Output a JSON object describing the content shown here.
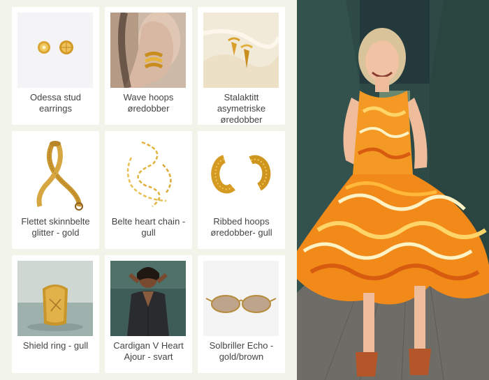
{
  "products": [
    {
      "name": "Odessa stud earrings",
      "thumb_icon": "stud-earrings-icon"
    },
    {
      "name": "Wave hoops øredobber",
      "thumb_icon": "wave-hoop-earring-icon"
    },
    {
      "name": "Stalaktitt asymetriske øredobber",
      "thumb_icon": "stalactite-earrings-icon"
    },
    {
      "name": "Flettet skinnbelte glitter - gold",
      "thumb_icon": "braided-belt-icon"
    },
    {
      "name": "Belte heart chain - gull",
      "thumb_icon": "heart-chain-belt-icon"
    },
    {
      "name": "Ribbed hoops øredobber- gull",
      "thumb_icon": "ribbed-hoop-earrings-icon"
    },
    {
      "name": "Shield ring - gull",
      "thumb_icon": "shield-ring-icon"
    },
    {
      "name": "Cardigan V Heart Ajour - svart",
      "thumb_icon": "cardigan-model-icon"
    },
    {
      "name": "Solbriller Echo - gold/brown",
      "thumb_icon": "sunglasses-icon"
    }
  ],
  "colors": {
    "page_bg": "#f2f4e9",
    "card_bg": "#ffffff",
    "label_text": "#444444",
    "gold": "#d7a22a",
    "dress_orange": "#f08a1c",
    "wall_green": "#2c4a45"
  },
  "model_photo": {
    "icon": "model-orange-dress-photo"
  }
}
